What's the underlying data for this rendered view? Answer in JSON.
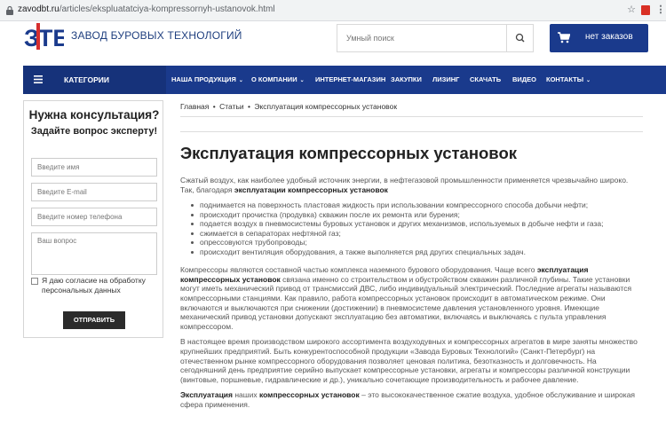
{
  "browser": {
    "url_host": "zavodbt.ru",
    "url_path": "/articles/ekspluatatciya-kompressornyh-ustanovok.html",
    "icons": [
      "lock-icon",
      "star-icon",
      "pdf-icon",
      "menu-dots-icon"
    ]
  },
  "header": {
    "logo_text": "ЗТБ",
    "company_name": "ЗАВОД БУРОВЫХ ТЕХНОЛОГИЙ",
    "search_placeholder": "Умный поиск",
    "cart_label": "нет заказов",
    "brand_color": "#1a3a8c"
  },
  "nav": {
    "categories_label": "КАТЕГОРИИ",
    "items": [
      {
        "label": "НАША ПРОДУКЦИЯ",
        "dropdown": true
      },
      {
        "label": "О КОМПАНИИ",
        "dropdown": true
      },
      {
        "label": "ИНТЕРНЕТ-МАГАЗИН",
        "dropdown": false
      },
      {
        "label": "ЗАКУПКИ",
        "dropdown": false
      },
      {
        "label": "ЛИЗИНГ",
        "dropdown": false
      },
      {
        "label": "СКАЧАТЬ",
        "dropdown": false
      },
      {
        "label": "ВИДЕО",
        "dropdown": false
      },
      {
        "label": "КОНТАКТЫ",
        "dropdown": true
      }
    ]
  },
  "consult": {
    "title": "Нужна консультация?",
    "subtitle": "Задайте вопрос эксперту!",
    "name_placeholder": "Введите имя",
    "email_placeholder": "Введите E-mail",
    "phone_placeholder": "Введите номер телефона",
    "question_placeholder": "Ваш вопрос",
    "consent": "Я даю согласие на обработку персональных данных",
    "submit": "ОТПРАВИТЬ"
  },
  "breadcrumb": [
    "Главная",
    "Статьи",
    "Эксплуатация компрессорных установок"
  ],
  "breadcrumb_sep": "•",
  "article": {
    "title": "Эксплуатация компрессорных установок",
    "intro_a": "Сжатый воздух, как наиболее удобный источник энергии, в нефтегазовой промышленности применяется чрезвычайно широко. Так, благодаря ",
    "intro_b": "эксплуатации компрессорных установок",
    "bullets": [
      "поднимается на поверхность пластовая жидкость при использовании компрессорного способа добычи нефти;",
      "происходит прочистка (продувка) скважин после их ремонта или бурения;",
      "подается воздух в пневмосистемы буровых установок и других механизмов, используемых в добыче нефти и газа;",
      "сжимается в сепараторах нефтяной газ;",
      "опрессовуются трубопроводы;",
      "происходит вентиляция оборудования, а также выполняется ряд других специальных задач."
    ],
    "p2_a": "Компрессоры являются составной частью комплекса наземного бурового оборудования. Чаще всего ",
    "p2_b": "эксплуатация компрессорных установок",
    "p2_c": " связана именно со строительством и обустройством скважин различной глубины. Такие установки могут иметь механический привод от трансмиссий ДВС, либо индивидуальный электрический. Последние агрегаты называются компрессорными станциями. Как правило, работа компрессорных установок происходит в автоматическом режиме. Они включаются и выключаются при снижении (достижении) в пневмосистеме давления установленного уровня. Имеющие механический привод установки допускают эксплуатацию без автоматики, включаясь и выключаясь с пульта управления компрессором.",
    "p3": "В настоящее время производством широкого ассортимента воздуходувных и компрессорных агрегатов в мире заняты множество крупнейших предприятий. Быть конкурентоспособной продукции «Завода Буровых Технологий» (Санкт-Петербург) на отечественном рынке компрессорного оборудования позволяет ценовая политика, безотказность и долговечность. На сегодняшний день предприятие серийно выпускает компрессорные установки, агрегаты и компрессоры различной конструкции (винтовые, поршневые, гидравлические и др.), уникально сочетающие производительность и рабочее давление.",
    "p4_a": "Эксплуатация",
    "p4_b": " наших ",
    "p4_c": "компрессорных установок",
    "p4_d": " – это высококачественное сжатие воздуха, удобное обслуживание и широкая сфера применения."
  }
}
